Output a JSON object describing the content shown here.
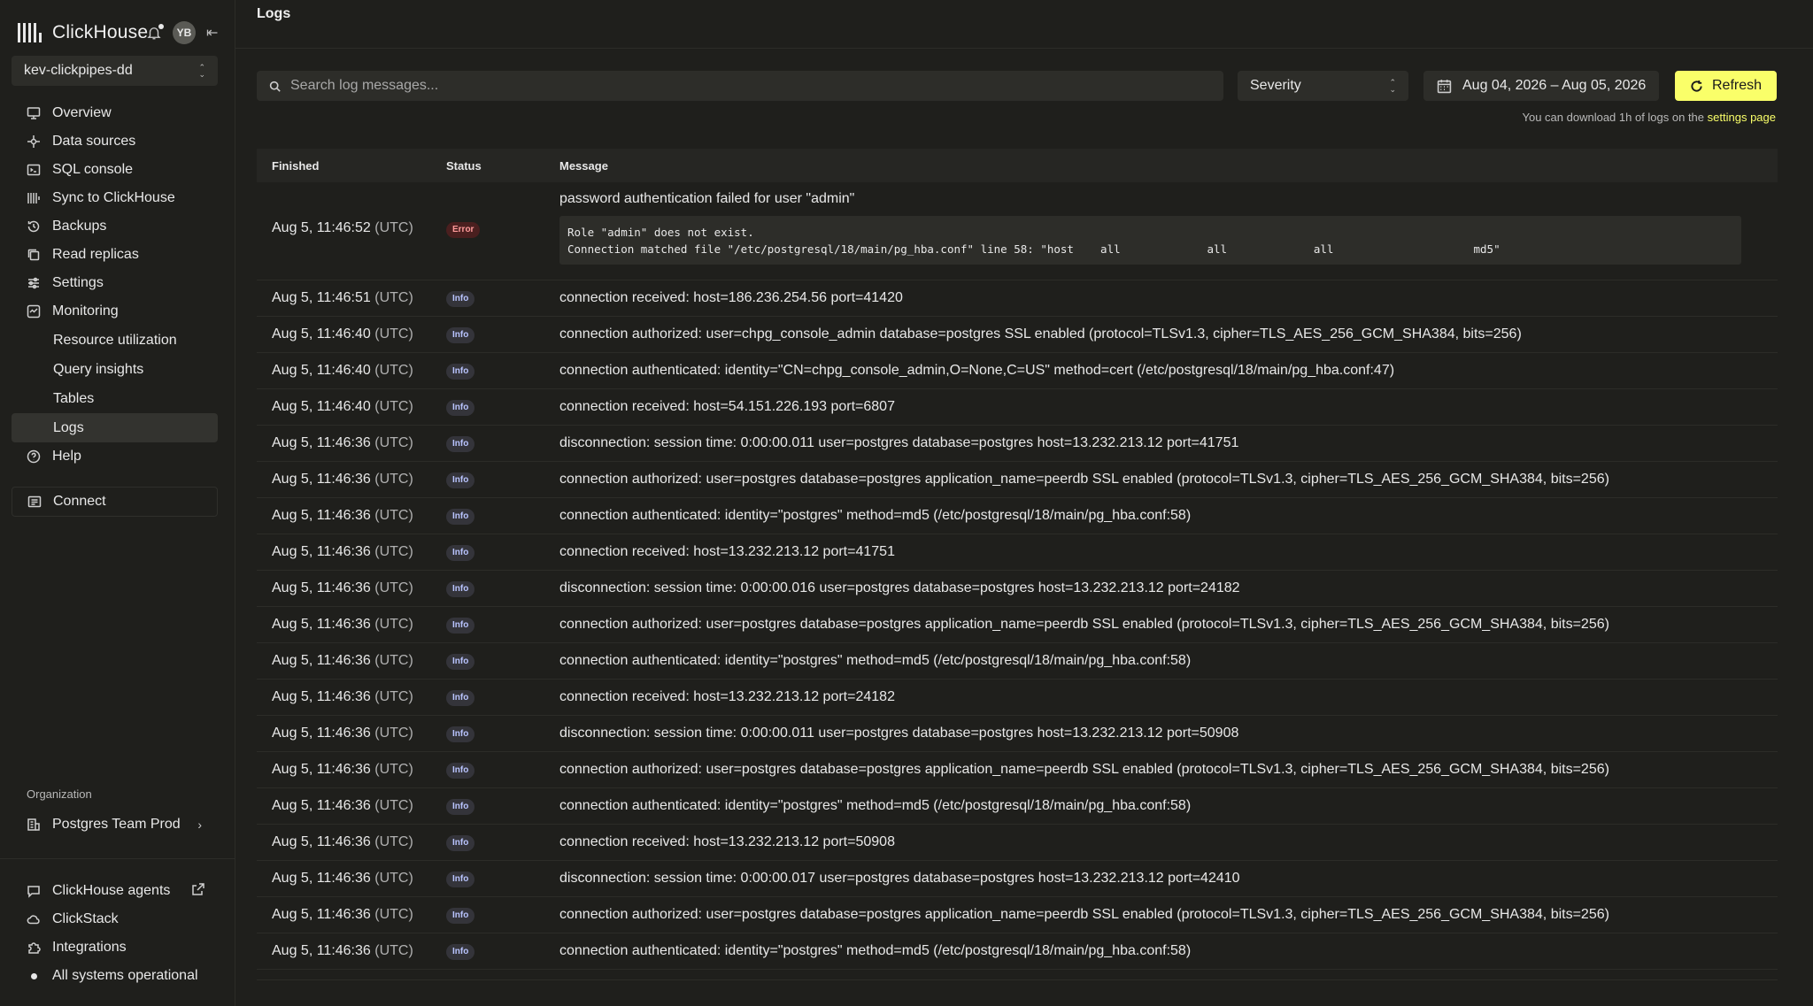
{
  "brand": {
    "name": "ClickHouse",
    "avatar_initials": "YB"
  },
  "service": {
    "name": "kev-clickpipes-dd"
  },
  "nav": {
    "items": [
      {
        "label": "Overview",
        "icon": "monitor-icon"
      },
      {
        "label": "Data sources",
        "icon": "data-sources-icon"
      },
      {
        "label": "SQL console",
        "icon": "terminal-icon"
      },
      {
        "label": "Sync to ClickHouse",
        "icon": "clickhouse-bars-icon"
      },
      {
        "label": "Backups",
        "icon": "history-icon"
      },
      {
        "label": "Read replicas",
        "icon": "copy-icon"
      },
      {
        "label": "Settings",
        "icon": "sliders-icon"
      },
      {
        "label": "Monitoring",
        "icon": "activity-icon"
      }
    ],
    "monitoring_sub": [
      "Resource utilization",
      "Query insights",
      "Tables",
      "Logs"
    ],
    "help": "Help",
    "connect": "Connect"
  },
  "organization": {
    "label": "Organization",
    "name": "Postgres Team Prod"
  },
  "bottom_nav": {
    "agents": "ClickHouse agents",
    "clickstack": "ClickStack",
    "integrations": "Integrations",
    "status": "All systems operational"
  },
  "page": {
    "title": "Logs"
  },
  "toolbar": {
    "search_placeholder": "Search log messages...",
    "severity_label": "Severity",
    "date_range": "Aug 04, 2026 – Aug 05, 2026",
    "refresh_label": "Refresh",
    "note_prefix": "You can download 1h of logs on the",
    "note_link": "settings page"
  },
  "table": {
    "headers": {
      "finished": "Finished",
      "status": "Status",
      "message": "Message"
    },
    "tz": "(UTC)",
    "error_row": {
      "time": "Aug 5, 11:46:52",
      "status": "Error",
      "message": "password authentication failed for user \"admin\"",
      "detail_line1": "Role \"admin\" does not exist.",
      "detail_line2": "Connection matched file \"/etc/postgresql/18/main/pg_hba.conf\" line 58: \"host    all             all             all                     md5\""
    },
    "rows": [
      {
        "time": "Aug 5, 11:46:51",
        "status": "Info",
        "message": "connection received: host=186.236.254.56 port=41420"
      },
      {
        "time": "Aug 5, 11:46:40",
        "status": "Info",
        "message": "connection authorized: user=chpg_console_admin database=postgres SSL enabled (protocol=TLSv1.3, cipher=TLS_AES_256_GCM_SHA384, bits=256)"
      },
      {
        "time": "Aug 5, 11:46:40",
        "status": "Info",
        "message": "connection authenticated: identity=\"CN=chpg_console_admin,O=None,C=US\" method=cert (/etc/postgresql/18/main/pg_hba.conf:47)"
      },
      {
        "time": "Aug 5, 11:46:40",
        "status": "Info",
        "message": "connection received: host=54.151.226.193 port=6807"
      },
      {
        "time": "Aug 5, 11:46:36",
        "status": "Info",
        "message": "disconnection: session time: 0:00:00.011 user=postgres database=postgres host=13.232.213.12 port=41751"
      },
      {
        "time": "Aug 5, 11:46:36",
        "status": "Info",
        "message": "connection authorized: user=postgres database=postgres application_name=peerdb SSL enabled (protocol=TLSv1.3, cipher=TLS_AES_256_GCM_SHA384, bits=256)"
      },
      {
        "time": "Aug 5, 11:46:36",
        "status": "Info",
        "message": "connection authenticated: identity=\"postgres\" method=md5 (/etc/postgresql/18/main/pg_hba.conf:58)"
      },
      {
        "time": "Aug 5, 11:46:36",
        "status": "Info",
        "message": "connection received: host=13.232.213.12 port=41751"
      },
      {
        "time": "Aug 5, 11:46:36",
        "status": "Info",
        "message": "disconnection: session time: 0:00:00.016 user=postgres database=postgres host=13.232.213.12 port=24182"
      },
      {
        "time": "Aug 5, 11:46:36",
        "status": "Info",
        "message": "connection authorized: user=postgres database=postgres application_name=peerdb SSL enabled (protocol=TLSv1.3, cipher=TLS_AES_256_GCM_SHA384, bits=256)"
      },
      {
        "time": "Aug 5, 11:46:36",
        "status": "Info",
        "message": "connection authenticated: identity=\"postgres\" method=md5 (/etc/postgresql/18/main/pg_hba.conf:58)"
      },
      {
        "time": "Aug 5, 11:46:36",
        "status": "Info",
        "message": "connection received: host=13.232.213.12 port=24182"
      },
      {
        "time": "Aug 5, 11:46:36",
        "status": "Info",
        "message": "disconnection: session time: 0:00:00.011 user=postgres database=postgres host=13.232.213.12 port=50908"
      },
      {
        "time": "Aug 5, 11:46:36",
        "status": "Info",
        "message": "connection authorized: user=postgres database=postgres application_name=peerdb SSL enabled (protocol=TLSv1.3, cipher=TLS_AES_256_GCM_SHA384, bits=256)"
      },
      {
        "time": "Aug 5, 11:46:36",
        "status": "Info",
        "message": "connection authenticated: identity=\"postgres\" method=md5 (/etc/postgresql/18/main/pg_hba.conf:58)"
      },
      {
        "time": "Aug 5, 11:46:36",
        "status": "Info",
        "message": "connection received: host=13.232.213.12 port=50908"
      },
      {
        "time": "Aug 5, 11:46:36",
        "status": "Info",
        "message": "disconnection: session time: 0:00:00.017 user=postgres database=postgres host=13.232.213.12 port=42410"
      },
      {
        "time": "Aug 5, 11:46:36",
        "status": "Info",
        "message": "connection authorized: user=postgres database=postgres application_name=peerdb SSL enabled (protocol=TLSv1.3, cipher=TLS_AES_256_GCM_SHA384, bits=256)"
      },
      {
        "time": "Aug 5, 11:46:36",
        "status": "Info",
        "message": "connection authenticated: identity=\"postgres\" method=md5 (/etc/postgresql/18/main/pg_hba.conf:58)"
      }
    ]
  },
  "colors": {
    "accent": "#faff69",
    "background": "#1f1f1c",
    "error_badge": "#4a1f1f",
    "info_badge_text": "#b9c4ff"
  }
}
